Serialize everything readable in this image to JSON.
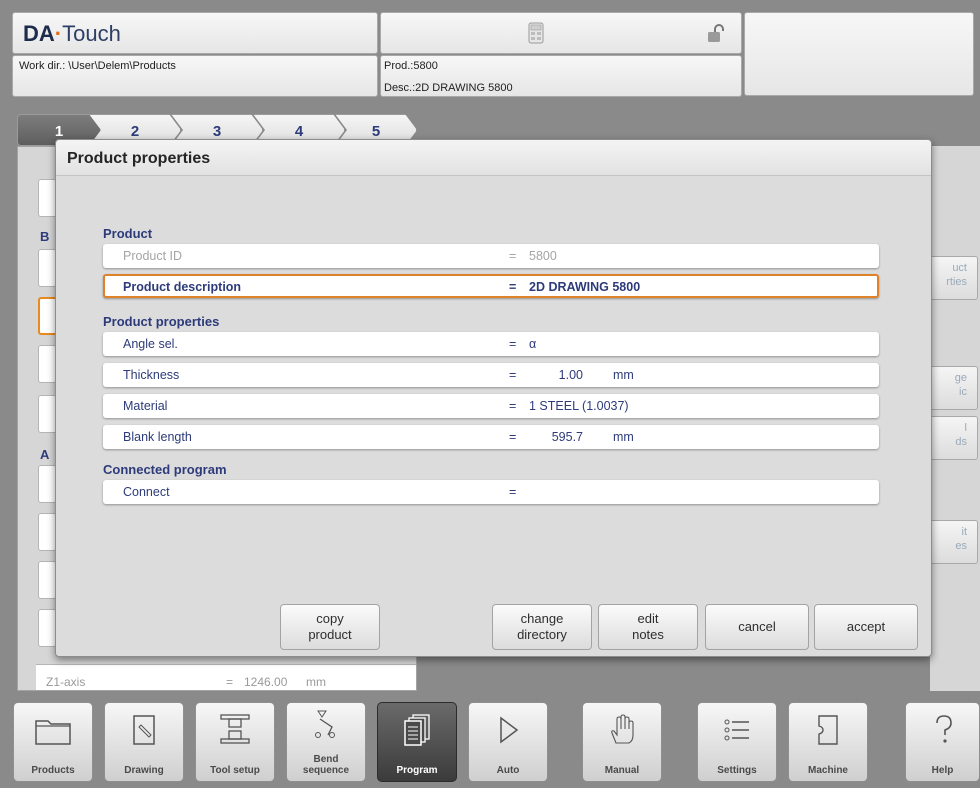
{
  "header": {
    "logo_brand": "DA",
    "logo_dot": "·",
    "logo_rest": "Touch",
    "work_dir": "Work dir.: \\User\\Delem\\Products",
    "prod": "Prod.:5800",
    "desc": "Desc.:2D DRAWING 5800",
    "icons": [
      "calculator-icon",
      "unlock-icon"
    ]
  },
  "tabs": [
    "1",
    "2",
    "3",
    "4",
    "5"
  ],
  "background": {
    "labels": [
      "B",
      "A"
    ],
    "z1_label": "Z1-axis",
    "z1_eq": "=",
    "z1_value": "1246.00",
    "z1_unit": "mm",
    "right_buttons": [
      {
        "line1": "uct",
        "line2": "rties"
      },
      {
        "line1": "ge",
        "line2": "ic"
      },
      {
        "line1": "l",
        "line2": "ds"
      },
      {
        "line1": "it",
        "line2": "es"
      }
    ]
  },
  "dialog": {
    "title": "Product properties",
    "sections": {
      "product": "Product",
      "properties": "Product properties",
      "connected": "Connected program"
    },
    "rows": {
      "product_id": {
        "label": "Product ID",
        "eq": "=",
        "value": "5800"
      },
      "product_description": {
        "label": "Product description",
        "eq": "=",
        "value": "2D DRAWING 5800"
      },
      "angle_sel": {
        "label": "Angle sel.",
        "eq": "=",
        "value": "α"
      },
      "thickness": {
        "label": "Thickness",
        "eq": "=",
        "value": "1.00",
        "unit": "mm"
      },
      "material": {
        "label": "Material",
        "eq": "=",
        "value": "1 STEEL (1.0037)"
      },
      "blank_length": {
        "label": "Blank length",
        "eq": "=",
        "value": "595.7",
        "unit": "mm"
      },
      "connect": {
        "label": "Connect",
        "eq": "=",
        "value": ""
      }
    },
    "buttons": {
      "copy_product": {
        "line1": "copy",
        "line2": "product"
      },
      "change_directory": {
        "line1": "change",
        "line2": "directory"
      },
      "edit_notes": {
        "line1": "edit",
        "line2": "notes"
      },
      "cancel": "cancel",
      "accept": "accept"
    }
  },
  "toolbar": {
    "products": "Products",
    "drawing": "Drawing",
    "tool_setup": "Tool setup",
    "bend_sequence_1": "Bend",
    "bend_sequence_2": "sequence",
    "program": "Program",
    "auto": "Auto",
    "manual": "Manual",
    "settings": "Settings",
    "machine": "Machine",
    "help": "Help"
  },
  "colors": {
    "accent_orange": "#e0822a",
    "label_blue": "#2d3b7a",
    "active_tab": "#5e5e5e"
  }
}
